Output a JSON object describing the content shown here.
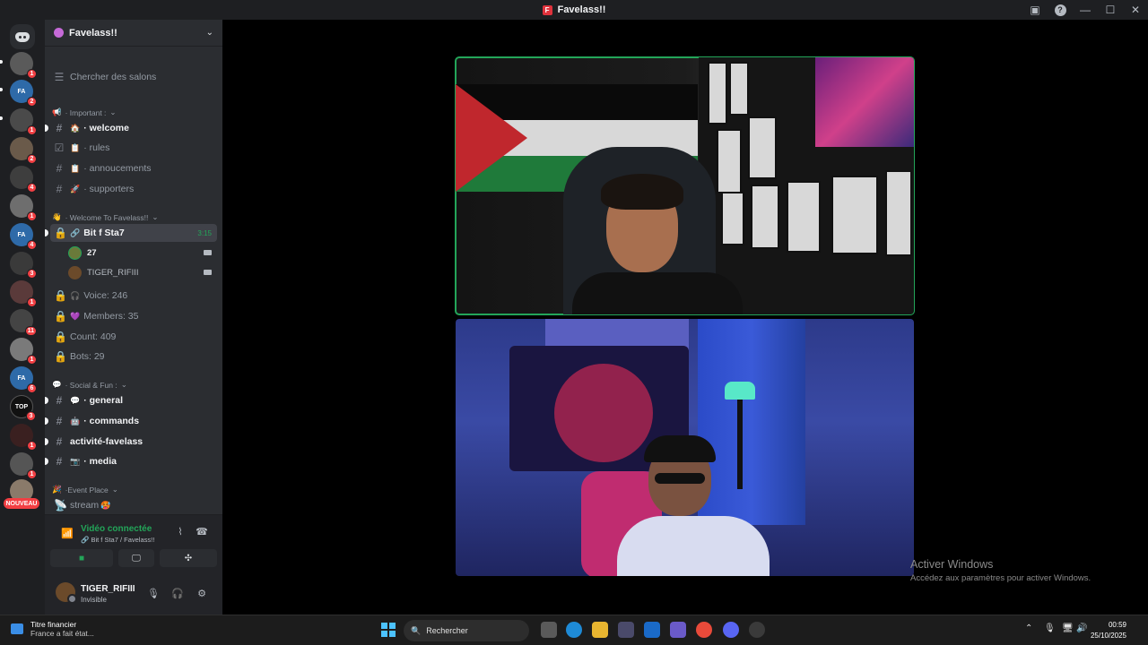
{
  "window": {
    "title": "Favelass!!",
    "logo_letter": "F"
  },
  "server": {
    "name": "Favelass!!"
  },
  "guild_badges": [
    "1",
    "2",
    "1",
    "2",
    "4",
    "1",
    "4",
    "3",
    "1",
    "11",
    "1",
    "6",
    "3",
    "1",
    "1"
  ],
  "guild_new_label": "NOUVEAU",
  "search_channels": "Chercher des salons",
  "categories": {
    "important": "· Important :",
    "welcome": "· Welcome To Favelass!!",
    "social": "· Social & Fun :",
    "event": "·Event Place"
  },
  "channels": {
    "welcome": "· welcome",
    "rules": "· rules",
    "annoucements": "· annoucements",
    "supporters": "· supporters",
    "bitfsta7": "Bit f Sta7",
    "bitfsta7_time": "3:15",
    "voice_count": "Voice: 246",
    "members": "Members: 35",
    "count": "Count: 409",
    "bots": "Bots: 29",
    "general": "· general",
    "commands": "· commands",
    "activite": "activité-favelass",
    "media": "· media",
    "stream": "stream"
  },
  "voice_users": [
    {
      "name": "27"
    },
    {
      "name": "TIGER_RIFIII"
    }
  ],
  "voice_panel": {
    "status": "Vidéo connectée",
    "sub": "Bit f Sta7 / Favelass!!"
  },
  "user_panel": {
    "name": "TIGER_RIFIII",
    "status": "Invisible"
  },
  "activate_windows": {
    "title": "Activer Windows",
    "sub": "Accédez aux paramètres pour activer Windows."
  },
  "taskbar": {
    "news_title": "Titre financier",
    "news_sub": "France a fait état...",
    "search": "Rechercher",
    "time": "00:59",
    "date": "25/10/2025"
  },
  "colors": {
    "accent_green": "#23a559",
    "badge_red": "#f23f43",
    "sidebar_bg": "#2b2d31",
    "rail_bg": "#1e1f22"
  }
}
